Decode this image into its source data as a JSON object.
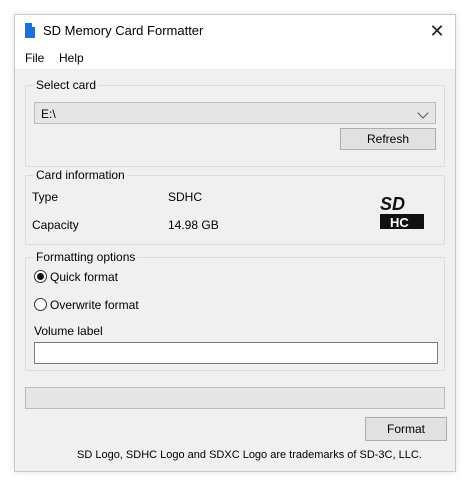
{
  "window": {
    "title": "SD Memory Card Formatter",
    "close_glyph": "✕"
  },
  "menu": {
    "file": "File",
    "help": "Help"
  },
  "select_card": {
    "group_title": "Select card",
    "selected": "E:\\",
    "refresh_label": "Refresh"
  },
  "card_info": {
    "group_title": "Card information",
    "type_label": "Type",
    "type_value": "SDHC",
    "capacity_label": "Capacity",
    "capacity_value": "14.98 GB",
    "logo_icon": "sdhc-logo-icon",
    "logo_top": "SD",
    "logo_bottom": "HC"
  },
  "formatting": {
    "group_title": "Formatting options",
    "quick_label": "Quick format",
    "overwrite_label": "Overwrite format",
    "selected_option": "Quick format",
    "volume_label_caption": "Volume label",
    "volume_label_value": ""
  },
  "progress": {
    "value": 0
  },
  "footer": {
    "format_label": "Format",
    "trademark_text": "SD Logo, SDHC Logo and SDXC Logo are trademarks of SD-3C, LLC."
  },
  "colors": {
    "accent_icon": "#1f6fd6",
    "window_bg": "#f0f0f0"
  }
}
